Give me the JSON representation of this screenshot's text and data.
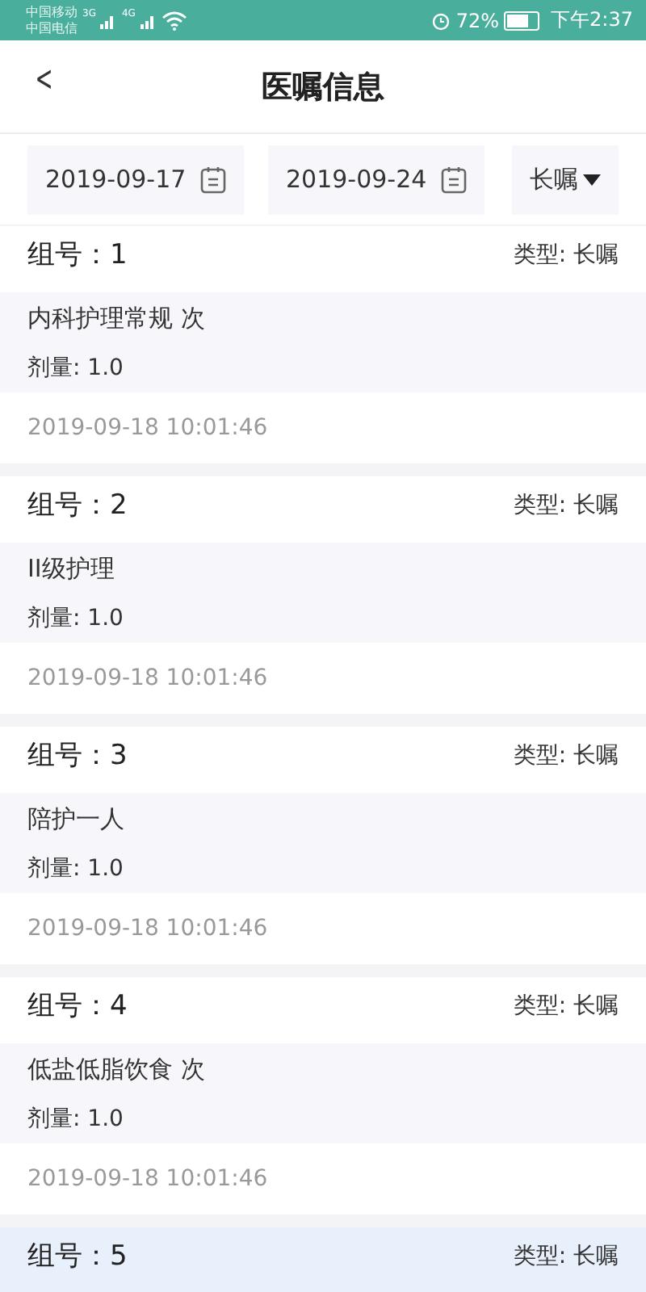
{
  "status_bar": {
    "carrier_1": "中国移动",
    "carrier_2": "中国电信",
    "network_1": "3G",
    "network_2": "4G",
    "battery_text": "72%",
    "time": "下午2:37"
  },
  "header": {
    "back": "<",
    "title": "医嘱信息"
  },
  "filters": {
    "start_date": "2019-09-17",
    "end_date": "2019-09-24",
    "type": "长嘱"
  },
  "orders": [
    {
      "group_label": "组号：1",
      "type_label": "类型: 长嘱",
      "item": "内科护理常规 次",
      "dose": "剂量: 1.0",
      "time": "2019-09-18 10:01:46",
      "selected": false
    },
    {
      "group_label": "组号：2",
      "type_label": "类型: 长嘱",
      "item": "II级护理",
      "dose": "剂量: 1.0",
      "time": "2019-09-18 10:01:46",
      "selected": false
    },
    {
      "group_label": "组号：3",
      "type_label": "类型: 长嘱",
      "item": "陪护一人",
      "dose": "剂量: 1.0",
      "time": "2019-09-18 10:01:46",
      "selected": false
    },
    {
      "group_label": "组号：4",
      "type_label": "类型: 长嘱",
      "item": "低盐低脂饮食 次",
      "dose": "剂量: 1.0",
      "time": "2019-09-18 10:01:46",
      "selected": false
    },
    {
      "group_label": "组号：5",
      "type_label": "类型: 长嘱",
      "selected": true
    }
  ]
}
